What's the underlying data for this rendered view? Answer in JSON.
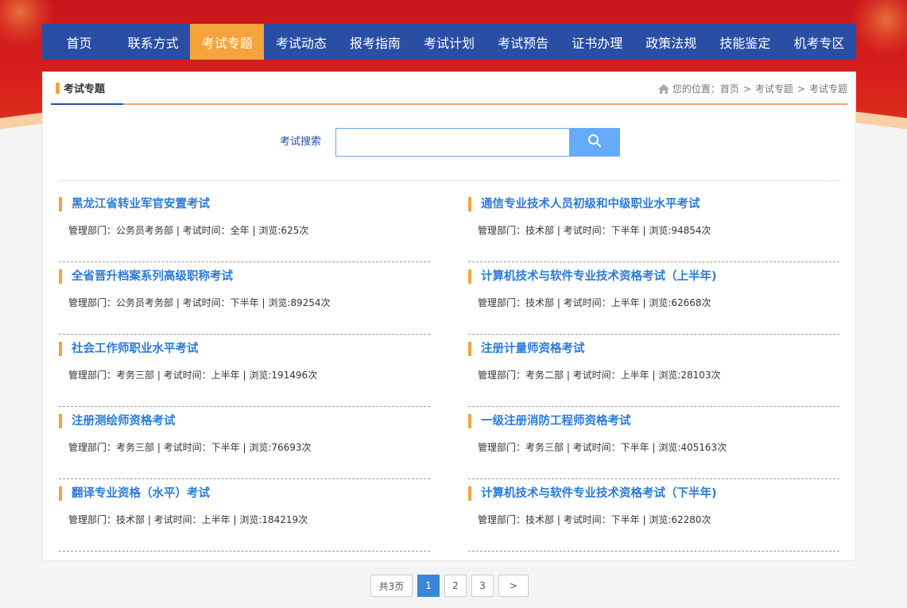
{
  "nav": {
    "items": [
      {
        "label": "首页",
        "active": false
      },
      {
        "label": "联系方式",
        "active": false
      },
      {
        "label": "考试专题",
        "active": true
      },
      {
        "label": "考试动态",
        "active": false
      },
      {
        "label": "报考指南",
        "active": false
      },
      {
        "label": "考试计划",
        "active": false
      },
      {
        "label": "考试预告",
        "active": false
      },
      {
        "label": "证书办理",
        "active": false
      },
      {
        "label": "政策法规",
        "active": false
      },
      {
        "label": "技能鉴定",
        "active": false
      },
      {
        "label": "机考专区",
        "active": false
      }
    ]
  },
  "panel": {
    "title": "考试专题",
    "breadcrumb": {
      "prefix": "您的位置：",
      "items": [
        "首页",
        "考试专题",
        "考试专题"
      ],
      "separator": ">"
    }
  },
  "search": {
    "label": "考试搜索",
    "placeholder": "",
    "value": "",
    "button_icon": "search-icon"
  },
  "exams": [
    {
      "title": "黑龙江省转业军官安置考试",
      "meta": "管理部门：公务员考务部 | 考试时间：全年 | 浏览:625次"
    },
    {
      "title": "通信专业技术人员初级和中级职业水平考试",
      "meta": "管理部门：技术部 | 考试时间：下半年 | 浏览:94854次"
    },
    {
      "title": "全省晋升档案系列高级职称考试",
      "meta": "管理部门：公务员考务部 | 考试时间：下半年 | 浏览:89254次"
    },
    {
      "title": "计算机技术与软件专业技术资格考试（上半年)",
      "meta": "管理部门：技术部 | 考试时间：上半年 | 浏览:62668次"
    },
    {
      "title": "社会工作师职业水平考试",
      "meta": "管理部门：考务三部 | 考试时间：上半年 | 浏览:191496次"
    },
    {
      "title": "注册计量师资格考试",
      "meta": "管理部门：考务二部 | 考试时间：上半年 | 浏览:28103次"
    },
    {
      "title": "注册测绘师资格考试",
      "meta": "管理部门：考务三部 | 考试时间：下半年 | 浏览:76693次"
    },
    {
      "title": "一级注册消防工程师资格考试",
      "meta": "管理部门：考务三部 | 考试时间：下半年 | 浏览:405163次"
    },
    {
      "title": "翻译专业资格（水平）考试",
      "meta": "管理部门：技术部 | 考试时间：上半年 | 浏览:184219次"
    },
    {
      "title": "计算机技术与软件专业技术资格考试（下半年)",
      "meta": "管理部门：技术部 | 考试时间：下半年 | 浏览:62280次"
    }
  ],
  "pagination": {
    "total_label": "共3页",
    "pages": [
      "1",
      "2",
      "3"
    ],
    "current": "1",
    "next_label": ">"
  },
  "colors": {
    "nav_bg": "#2a4ea3",
    "nav_active": "#f5a33c",
    "title_link": "#2b7bd6",
    "accent_bar": "#f5a33c",
    "search_button": "#64acf7",
    "banner_red": "#d9221c"
  }
}
